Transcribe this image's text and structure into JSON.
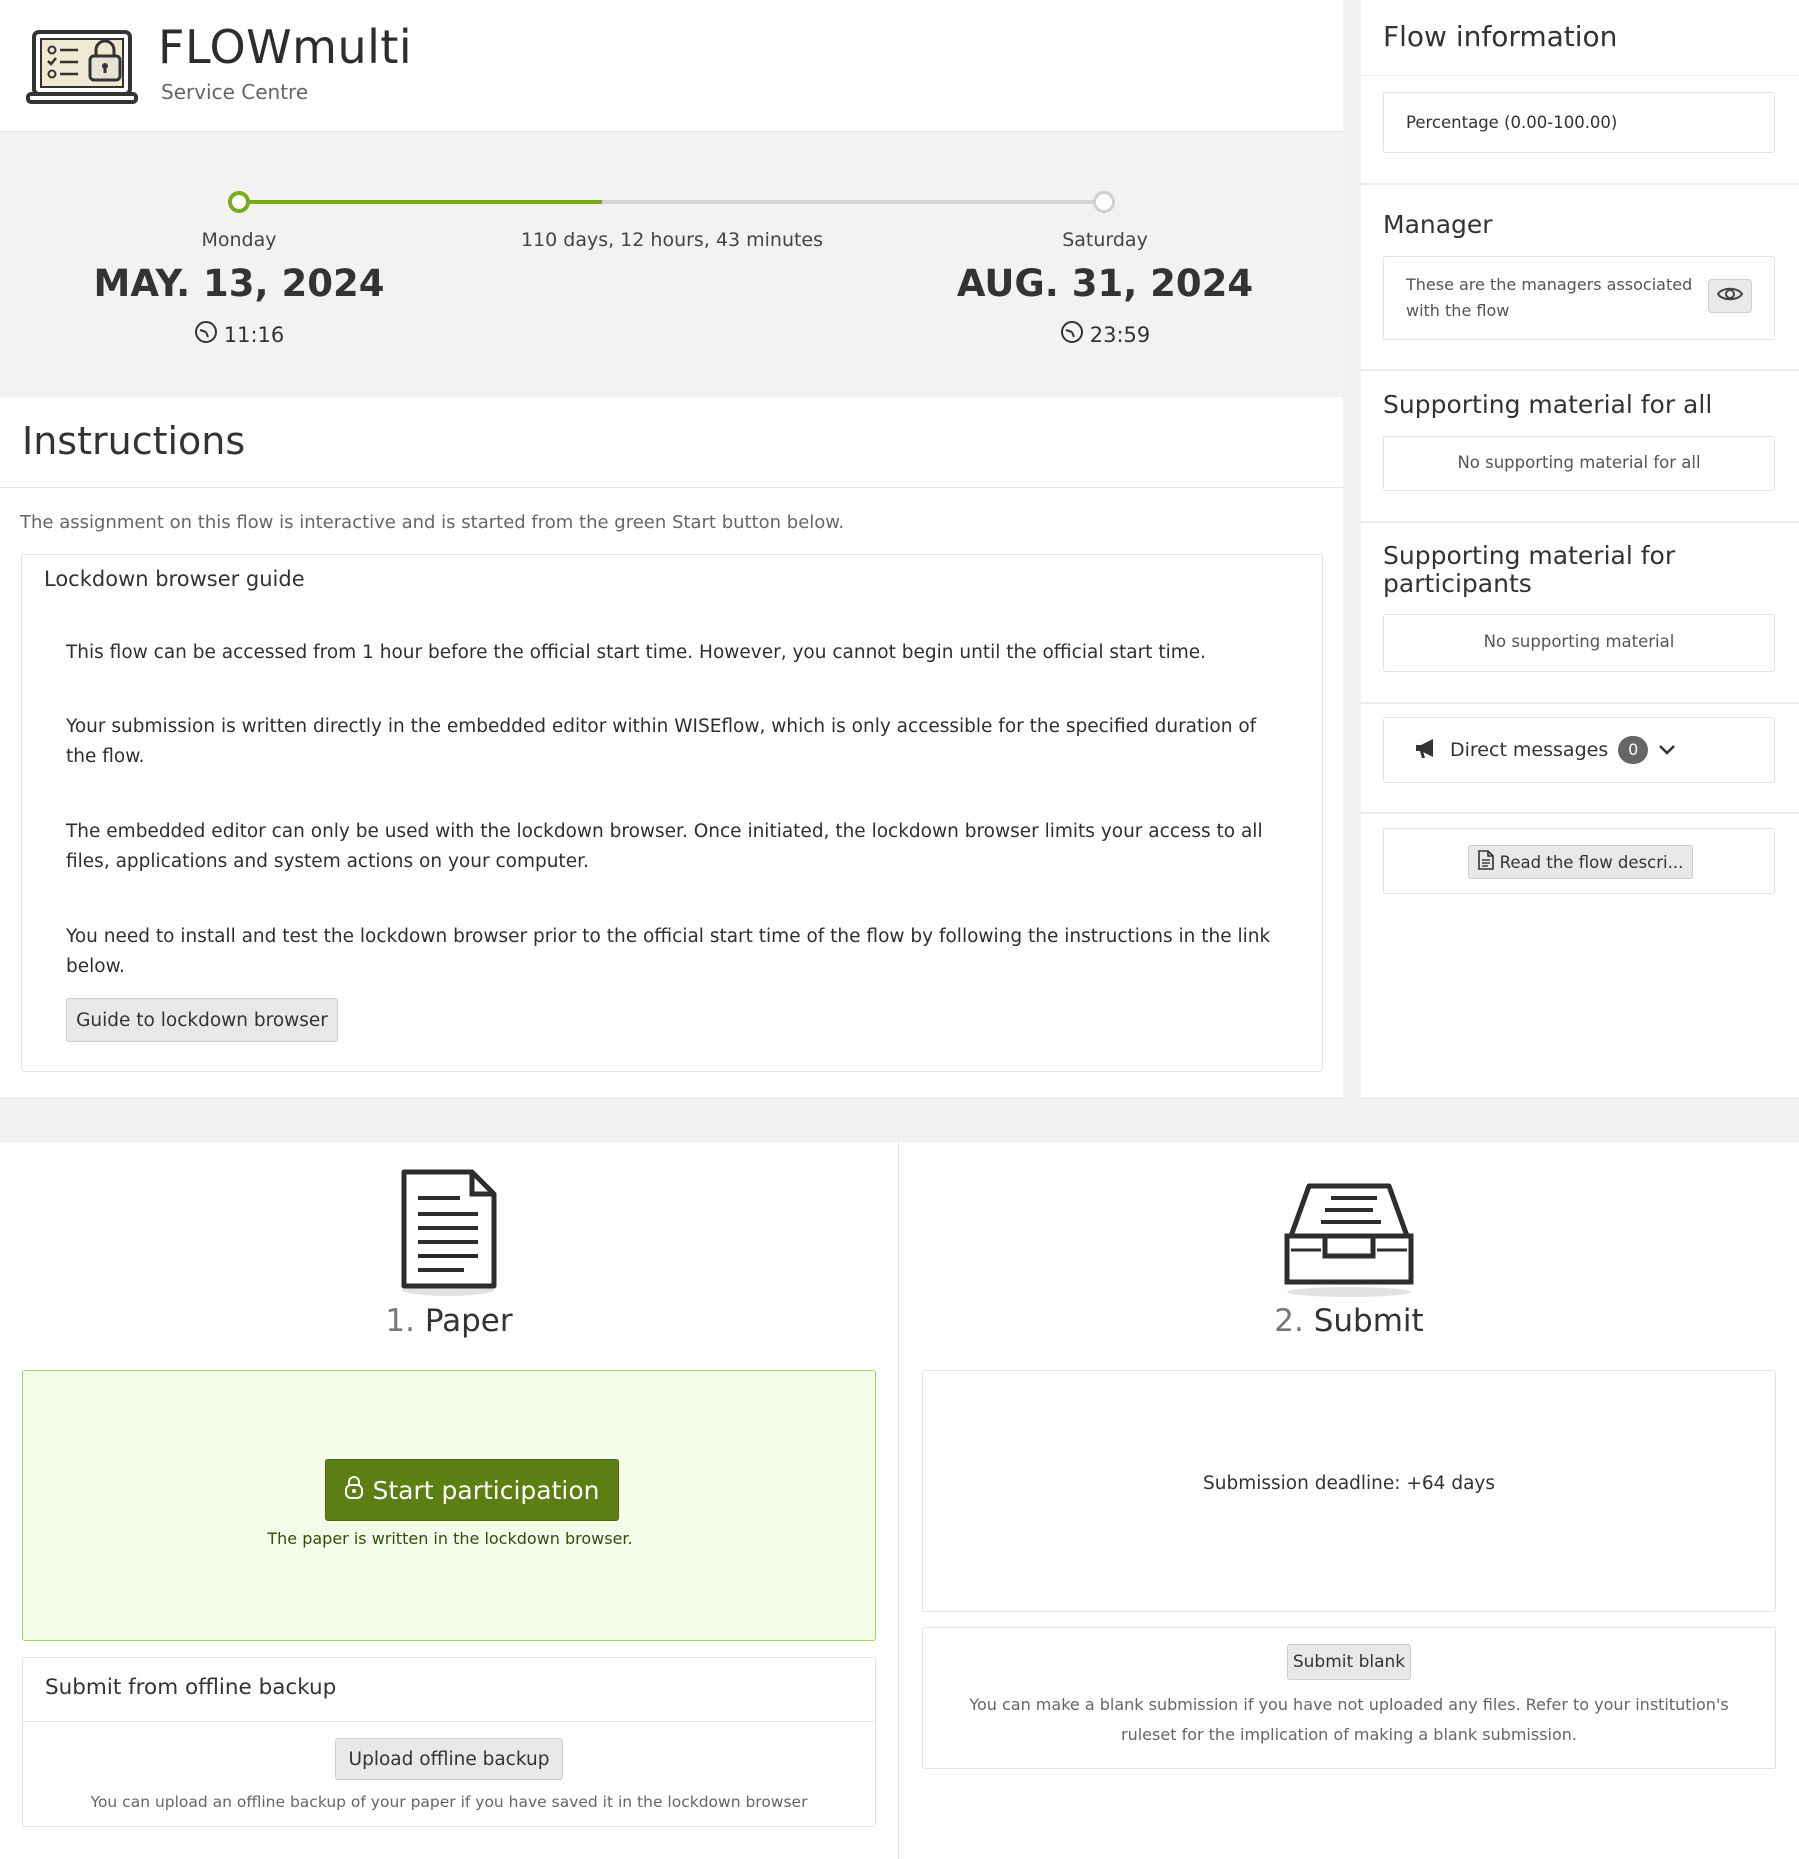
{
  "header": {
    "title": "FLOWmulti",
    "subtitle": "Service Centre"
  },
  "timeline": {
    "start_day": "Monday",
    "start_date": "MAY. 13, 2024",
    "start_time": "11:16",
    "duration": "110 days, 12 hours, 43 minutes",
    "end_day": "Saturday",
    "end_date": "AUG. 31, 2024",
    "end_time": "23:59",
    "progress_fraction": 0.42
  },
  "instructions": {
    "title": "Instructions",
    "intro": "The assignment on this flow is interactive and is started from the green Start button below.",
    "guide_title": "Lockdown browser guide",
    "paragraphs": [
      "This flow can be accessed from 1 hour before the official start time. However, you cannot begin until the official start time.",
      "Your submission is written directly in the embedded editor within WISEflow, which is only accessible for the specified duration of the flow.",
      "The embedded editor can only be used with the lockdown browser. Once initiated, the lockdown browser limits your access to all files, applications and system actions on your computer.",
      "You need to install and test the lockdown browser prior to the official start time of the flow by following the instructions in the link below."
    ],
    "guide_button": "Guide to lockdown browser"
  },
  "sidebar": {
    "flow_info_title": "Flow information",
    "grading": "Percentage (0.00-100.00)",
    "manager_title": "Manager",
    "manager_text": "These are the managers associated with the flow",
    "support_all_title": "Supporting material for all",
    "support_all_text": "No supporting material for all",
    "support_part_title": "Supporting material for participants",
    "support_part_text": "No supporting material",
    "direct_messages_label": "Direct messages",
    "direct_messages_count": "0",
    "read_description_button": "Read the flow descri..."
  },
  "steps": {
    "paper": {
      "number": "1.",
      "label": "Paper",
      "start_button": "Start participation",
      "start_note": "The paper is written in the lockdown browser.",
      "offline_title": "Submit from offline backup",
      "offline_button": "Upload offline backup",
      "offline_note": "You can upload an offline backup of your paper if you have saved it in the lockdown browser"
    },
    "submit": {
      "number": "2.",
      "label": "Submit",
      "deadline": "Submission deadline: +64 days",
      "blank_button": "Submit blank",
      "blank_note": "You can make a blank submission if you have not uploaded any files. Refer to your institution's ruleset for the implication of making a blank submission."
    }
  },
  "colors": {
    "accent_green": "#7da91e",
    "start_button": "#5c7e12",
    "top_accent": "#8a7a0a"
  }
}
